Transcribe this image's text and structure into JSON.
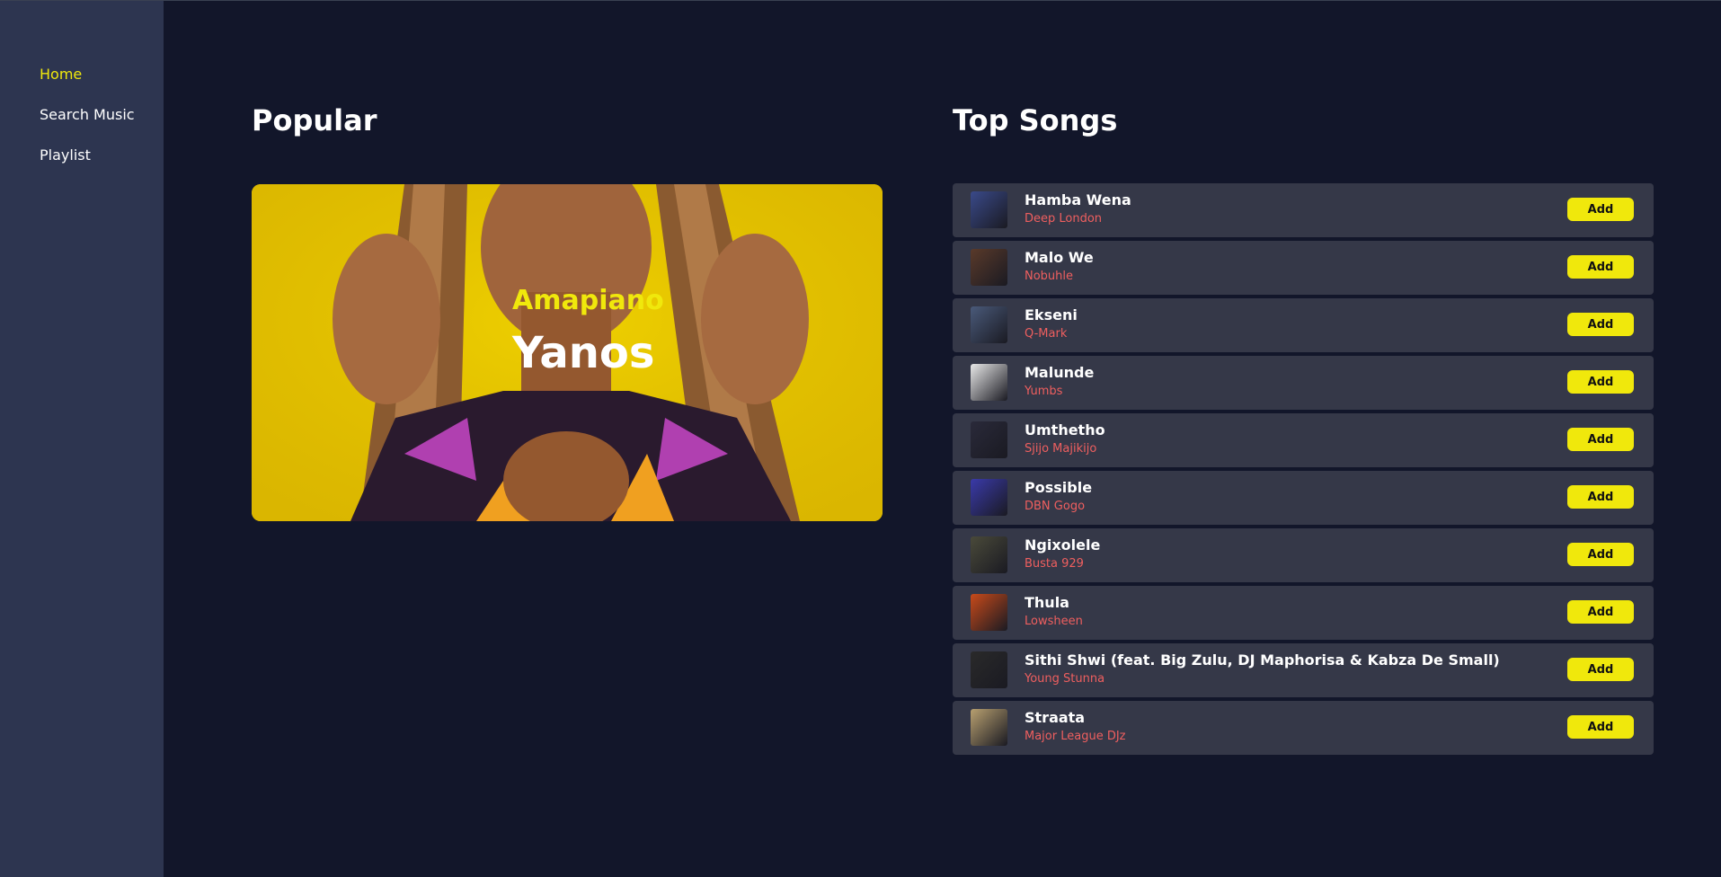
{
  "nav": {
    "items": [
      {
        "label": "Home",
        "active": true
      },
      {
        "label": "Search Music",
        "active": false
      },
      {
        "label": "Playlist",
        "active": false
      }
    ]
  },
  "popular": {
    "title": "Popular",
    "genre": "Amapiano",
    "artist": "Yanos"
  },
  "top_songs": {
    "title": "Top Songs",
    "add_label": "Add",
    "songs": [
      {
        "title": "Hamba Wena",
        "artist": "Deep London",
        "thumb_color": "#3a4a8a"
      },
      {
        "title": "Malo We",
        "artist": "Nobuhle",
        "thumb_color": "#5a3a2a"
      },
      {
        "title": "Ekseni",
        "artist": "Q-Mark",
        "thumb_color": "#4a5a7a"
      },
      {
        "title": "Malunde",
        "artist": "Yumbs",
        "thumb_color": "#e8e8e8"
      },
      {
        "title": "Umthetho",
        "artist": "Sjijo Majikijo",
        "thumb_color": "#2a2a3a"
      },
      {
        "title": "Possible",
        "artist": "DBN Gogo",
        "thumb_color": "#3a3aaa"
      },
      {
        "title": "Ngixolele",
        "artist": "Busta 929",
        "thumb_color": "#4a4a3a"
      },
      {
        "title": "Thula",
        "artist": "Lowsheen",
        "thumb_color": "#c84a1a"
      },
      {
        "title": "Sithi Shwi (feat. Big Zulu, DJ Maphorisa & Kabza De Small)",
        "artist": "Young Stunna",
        "thumb_color": "#2a2a2a"
      },
      {
        "title": "Straata",
        "artist": "Major League DJz",
        "thumb_color": "#b8a070"
      }
    ]
  },
  "colors": {
    "background": "#12162a",
    "sidebar": "#2d3550",
    "accent": "#f0e80c",
    "artist_text": "#ef5f5f",
    "row_bg": "#353848"
  }
}
